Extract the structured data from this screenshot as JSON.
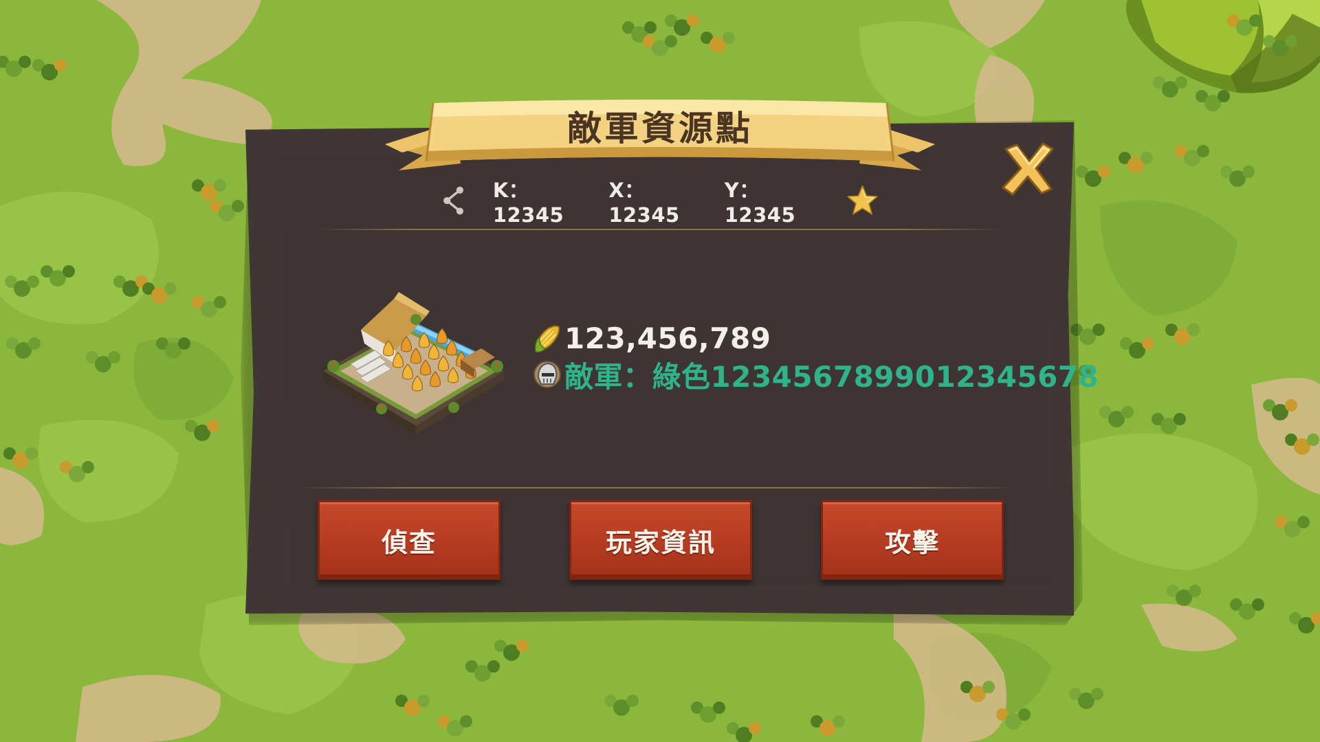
{
  "dialog": {
    "title": "敵軍資源點",
    "coords": {
      "k": "K：12345",
      "x": "X：12345",
      "y": "Y：12345"
    },
    "resource": {
      "icon": "corn-icon",
      "amount": "123,456,789"
    },
    "owner": {
      "icon": "helmet-icon",
      "text": "敵軍：綠色1234567899012345678"
    },
    "buttons": {
      "scout": "偵查",
      "player_info": "玩家資訊",
      "attack": "攻擊"
    }
  },
  "icons": {
    "share": "share-icon",
    "favorite": "star-icon",
    "close": "close-icon",
    "building": "farm-building"
  },
  "colors": {
    "panel": "#3f3635",
    "ribbon": "#f1cf7a",
    "button": "#b53b22",
    "owner_text": "#2fb38a",
    "close": "#f1c05a"
  }
}
